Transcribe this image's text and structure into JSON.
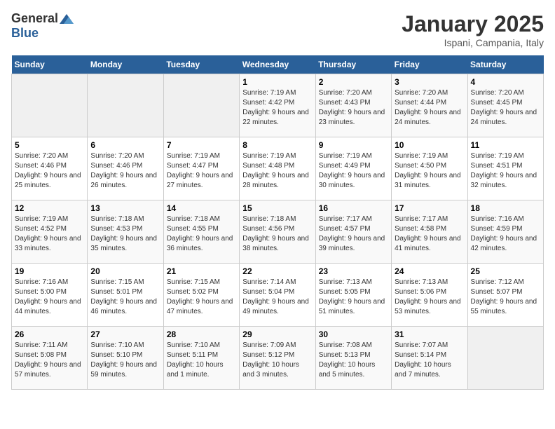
{
  "logo": {
    "general": "General",
    "blue": "Blue"
  },
  "title": "January 2025",
  "subtitle": "Ispani, Campania, Italy",
  "weekdays": [
    "Sunday",
    "Monday",
    "Tuesday",
    "Wednesday",
    "Thursday",
    "Friday",
    "Saturday"
  ],
  "weeks": [
    [
      {
        "day": "",
        "sunrise": "",
        "sunset": "",
        "daylight": ""
      },
      {
        "day": "",
        "sunrise": "",
        "sunset": "",
        "daylight": ""
      },
      {
        "day": "",
        "sunrise": "",
        "sunset": "",
        "daylight": ""
      },
      {
        "day": "1",
        "sunrise": "Sunrise: 7:19 AM",
        "sunset": "Sunset: 4:42 PM",
        "daylight": "Daylight: 9 hours and 22 minutes."
      },
      {
        "day": "2",
        "sunrise": "Sunrise: 7:20 AM",
        "sunset": "Sunset: 4:43 PM",
        "daylight": "Daylight: 9 hours and 23 minutes."
      },
      {
        "day": "3",
        "sunrise": "Sunrise: 7:20 AM",
        "sunset": "Sunset: 4:44 PM",
        "daylight": "Daylight: 9 hours and 24 minutes."
      },
      {
        "day": "4",
        "sunrise": "Sunrise: 7:20 AM",
        "sunset": "Sunset: 4:45 PM",
        "daylight": "Daylight: 9 hours and 24 minutes."
      }
    ],
    [
      {
        "day": "5",
        "sunrise": "Sunrise: 7:20 AM",
        "sunset": "Sunset: 4:46 PM",
        "daylight": "Daylight: 9 hours and 25 minutes."
      },
      {
        "day": "6",
        "sunrise": "Sunrise: 7:20 AM",
        "sunset": "Sunset: 4:46 PM",
        "daylight": "Daylight: 9 hours and 26 minutes."
      },
      {
        "day": "7",
        "sunrise": "Sunrise: 7:19 AM",
        "sunset": "Sunset: 4:47 PM",
        "daylight": "Daylight: 9 hours and 27 minutes."
      },
      {
        "day": "8",
        "sunrise": "Sunrise: 7:19 AM",
        "sunset": "Sunset: 4:48 PM",
        "daylight": "Daylight: 9 hours and 28 minutes."
      },
      {
        "day": "9",
        "sunrise": "Sunrise: 7:19 AM",
        "sunset": "Sunset: 4:49 PM",
        "daylight": "Daylight: 9 hours and 30 minutes."
      },
      {
        "day": "10",
        "sunrise": "Sunrise: 7:19 AM",
        "sunset": "Sunset: 4:50 PM",
        "daylight": "Daylight: 9 hours and 31 minutes."
      },
      {
        "day": "11",
        "sunrise": "Sunrise: 7:19 AM",
        "sunset": "Sunset: 4:51 PM",
        "daylight": "Daylight: 9 hours and 32 minutes."
      }
    ],
    [
      {
        "day": "12",
        "sunrise": "Sunrise: 7:19 AM",
        "sunset": "Sunset: 4:52 PM",
        "daylight": "Daylight: 9 hours and 33 minutes."
      },
      {
        "day": "13",
        "sunrise": "Sunrise: 7:18 AM",
        "sunset": "Sunset: 4:53 PM",
        "daylight": "Daylight: 9 hours and 35 minutes."
      },
      {
        "day": "14",
        "sunrise": "Sunrise: 7:18 AM",
        "sunset": "Sunset: 4:55 PM",
        "daylight": "Daylight: 9 hours and 36 minutes."
      },
      {
        "day": "15",
        "sunrise": "Sunrise: 7:18 AM",
        "sunset": "Sunset: 4:56 PM",
        "daylight": "Daylight: 9 hours and 38 minutes."
      },
      {
        "day": "16",
        "sunrise": "Sunrise: 7:17 AM",
        "sunset": "Sunset: 4:57 PM",
        "daylight": "Daylight: 9 hours and 39 minutes."
      },
      {
        "day": "17",
        "sunrise": "Sunrise: 7:17 AM",
        "sunset": "Sunset: 4:58 PM",
        "daylight": "Daylight: 9 hours and 41 minutes."
      },
      {
        "day": "18",
        "sunrise": "Sunrise: 7:16 AM",
        "sunset": "Sunset: 4:59 PM",
        "daylight": "Daylight: 9 hours and 42 minutes."
      }
    ],
    [
      {
        "day": "19",
        "sunrise": "Sunrise: 7:16 AM",
        "sunset": "Sunset: 5:00 PM",
        "daylight": "Daylight: 9 hours and 44 minutes."
      },
      {
        "day": "20",
        "sunrise": "Sunrise: 7:15 AM",
        "sunset": "Sunset: 5:01 PM",
        "daylight": "Daylight: 9 hours and 46 minutes."
      },
      {
        "day": "21",
        "sunrise": "Sunrise: 7:15 AM",
        "sunset": "Sunset: 5:02 PM",
        "daylight": "Daylight: 9 hours and 47 minutes."
      },
      {
        "day": "22",
        "sunrise": "Sunrise: 7:14 AM",
        "sunset": "Sunset: 5:04 PM",
        "daylight": "Daylight: 9 hours and 49 minutes."
      },
      {
        "day": "23",
        "sunrise": "Sunrise: 7:13 AM",
        "sunset": "Sunset: 5:05 PM",
        "daylight": "Daylight: 9 hours and 51 minutes."
      },
      {
        "day": "24",
        "sunrise": "Sunrise: 7:13 AM",
        "sunset": "Sunset: 5:06 PM",
        "daylight": "Daylight: 9 hours and 53 minutes."
      },
      {
        "day": "25",
        "sunrise": "Sunrise: 7:12 AM",
        "sunset": "Sunset: 5:07 PM",
        "daylight": "Daylight: 9 hours and 55 minutes."
      }
    ],
    [
      {
        "day": "26",
        "sunrise": "Sunrise: 7:11 AM",
        "sunset": "Sunset: 5:08 PM",
        "daylight": "Daylight: 9 hours and 57 minutes."
      },
      {
        "day": "27",
        "sunrise": "Sunrise: 7:10 AM",
        "sunset": "Sunset: 5:10 PM",
        "daylight": "Daylight: 9 hours and 59 minutes."
      },
      {
        "day": "28",
        "sunrise": "Sunrise: 7:10 AM",
        "sunset": "Sunset: 5:11 PM",
        "daylight": "Daylight: 10 hours and 1 minute."
      },
      {
        "day": "29",
        "sunrise": "Sunrise: 7:09 AM",
        "sunset": "Sunset: 5:12 PM",
        "daylight": "Daylight: 10 hours and 3 minutes."
      },
      {
        "day": "30",
        "sunrise": "Sunrise: 7:08 AM",
        "sunset": "Sunset: 5:13 PM",
        "daylight": "Daylight: 10 hours and 5 minutes."
      },
      {
        "day": "31",
        "sunrise": "Sunrise: 7:07 AM",
        "sunset": "Sunset: 5:14 PM",
        "daylight": "Daylight: 10 hours and 7 minutes."
      },
      {
        "day": "",
        "sunrise": "",
        "sunset": "",
        "daylight": ""
      }
    ]
  ]
}
